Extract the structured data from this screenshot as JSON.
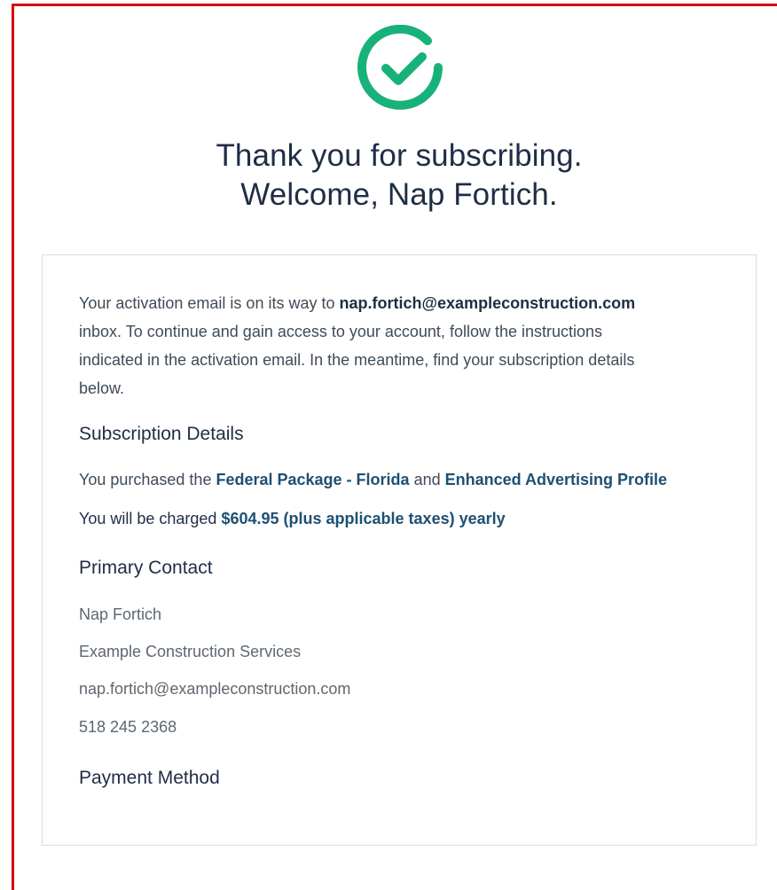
{
  "header": {
    "title_line_1": "Thank you for subscribing.",
    "title_line_2": "Welcome, Nap Fortich.",
    "success_icon": "check-circle-icon"
  },
  "card": {
    "intro": {
      "before_email": "Your activation email is on its way to ",
      "email": "nap.fortich@exampleconstruction.com",
      "after_email_line": "inbox. To continue and gain access to your account, follow the instructions",
      "line_3": "indicated in the activation email. In the meantime, find your subscription details",
      "line_4": "below."
    },
    "subscription": {
      "title": "Subscription Details",
      "purchased_prefix": "You purchased the ",
      "package": "Federal Package - Florida",
      "and": " and ",
      "addon": "Enhanced Advertising Profile",
      "charged_prefix": "You will be charged ",
      "price": "$604.95 (plus applicable taxes) yearly"
    },
    "primary_contact": {
      "title": "Primary Contact",
      "name": "Nap Fortich",
      "company": "Example Construction Services",
      "email": "nap.fortich@exampleconstruction.com",
      "phone": "518 245 2368"
    },
    "payment_method": {
      "title": "Payment Method"
    }
  },
  "colors": {
    "check": "#17b27a",
    "title": "#1f2d45",
    "frame": "#d80b0b",
    "highlight": "#1e4f73",
    "card_border": "#d8dde3"
  }
}
